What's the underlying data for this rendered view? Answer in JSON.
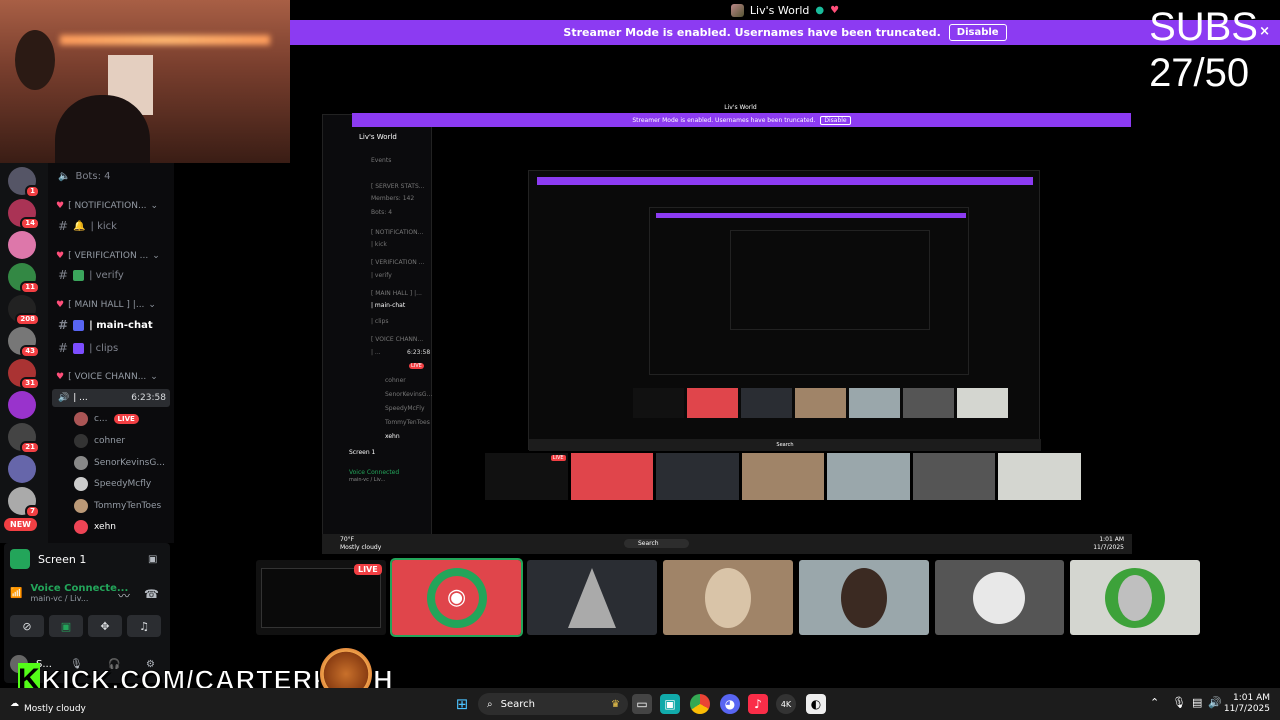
{
  "window": {
    "title": "Liv's World"
  },
  "banner": {
    "text": "Streamer Mode is enabled. Usernames have been truncated.",
    "disable_label": "Disable",
    "close_glyph": "×"
  },
  "overlay": {
    "subs_label": "SUBS",
    "subs_count": "27/50"
  },
  "guilds": [
    {
      "badge": "1",
      "color": "#556"
    },
    {
      "badge": "14",
      "color": "#a35"
    },
    {
      "badge": "",
      "color": "#d7a"
    },
    {
      "badge": "11",
      "color": "#384"
    },
    {
      "badge": "208",
      "color": "#222"
    },
    {
      "badge": "43",
      "color": "#777"
    },
    {
      "badge": "31",
      "color": "#a33"
    },
    {
      "badge": "",
      "color": "#93c"
    },
    {
      "badge": "21",
      "color": "#444"
    },
    {
      "badge": "",
      "color": "#66a"
    },
    {
      "badge": "7",
      "color": "#aaa"
    },
    {
      "badge": "",
      "color": "#393"
    }
  ],
  "guild_new_badge": "NEW",
  "channels": {
    "bots": "Bots: 4",
    "cat_notification": "[ NOTIFICATION...",
    "kick": "| kick",
    "cat_verification": "[ VERIFICATION ...",
    "verify": "| verify",
    "cat_main_hall": "[ MAIN HALL ] |...",
    "main_chat": "| main-chat",
    "clips": "| clips",
    "cat_voice": "[ VOICE CHANN...",
    "voice_channel": "| ...",
    "voice_timer": "6:23:58",
    "voice_users": [
      {
        "name": "c...",
        "live": "LIVE",
        "color": "#a55"
      },
      {
        "name": "cohner",
        "live": "",
        "color": "#333"
      },
      {
        "name": "SenorKevinsG...",
        "live": "",
        "color": "#888"
      },
      {
        "name": "SpeedyMcfly",
        "live": "",
        "color": "#ccc"
      },
      {
        "name": "TommyTenToes",
        "live": "",
        "color": "#b97"
      },
      {
        "name": "xehn",
        "live": "",
        "color": "#e45"
      }
    ]
  },
  "panel": {
    "screen_title": "Screen 1",
    "voice_status": "Voice Connecte...",
    "voice_channel": "main-vc / Liv...",
    "user_name": "S..."
  },
  "stream": {
    "mini_title": "Liv's World",
    "mini_banner": "Streamer Mode is enabled. Usernames have been truncated.",
    "mini_disable": "Disable",
    "mini_channels": [
      "Events",
      "[ SERVER STATS...",
      "Members: 142",
      "Bots: 4",
      "[ NOTIFICATION...",
      "| kick",
      "[ VERIFICATION ...",
      "| verify",
      "[ MAIN HALL ] |...",
      "| main-chat",
      "| clips",
      "[ VOICE CHANN...",
      "| ...",
      "cohner",
      "SenorKevinsG...",
      "SpeedyMcFly",
      "TommyTenToes",
      "xehn"
    ],
    "mini_screen": "Screen 1",
    "mini_voice": "Voice Connected",
    "mini_vc": "main-vc / Liv...",
    "mini_search": "Search",
    "mini_weather": "Mostly cloudy",
    "mini_time": "1:01 AM",
    "mini_date": "11/7/2025",
    "mini_live": "LIVE",
    "mini_timer": "6:23:58",
    "mini_temp": "70°F"
  },
  "tiles": [
    {
      "name": "screen-share",
      "bg": "#111",
      "live": "LIVE"
    },
    {
      "name": "discord-avatar",
      "bg": "#e0454b",
      "live": ""
    },
    {
      "name": "hood-avatar",
      "bg": "#2a2d33",
      "live": ""
    },
    {
      "name": "kitchen-avatar",
      "bg": "#a08468",
      "live": ""
    },
    {
      "name": "portrait-avatar",
      "bg": "#9aa7ab",
      "live": ""
    },
    {
      "name": "sketch-avatar",
      "bg": "#555",
      "live": ""
    },
    {
      "name": "bird-avatar",
      "bg": "#d4d6d0",
      "live": ""
    }
  ],
  "kick": {
    "logo": "K",
    "url": "KICK.COM/CARTERKASH"
  },
  "taskbar": {
    "weather": "Mostly cloudy",
    "search": "Search",
    "time": "1:01 AM",
    "date": "11/7/2025"
  }
}
